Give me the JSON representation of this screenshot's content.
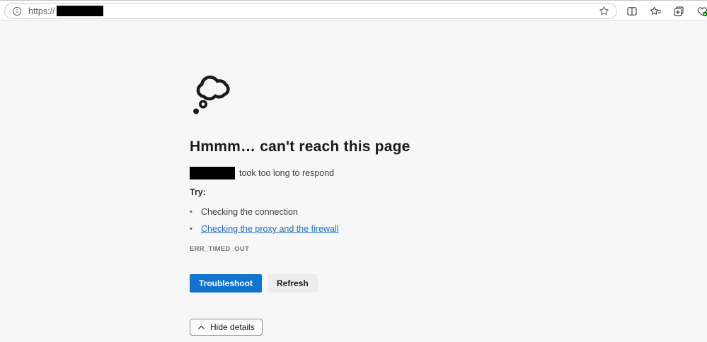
{
  "browser_chrome": {
    "address_bar": {
      "scheme": "https://",
      "url_redacted": true,
      "site_info_icon": "info-icon",
      "favorite_this_page_icon": "star-icon"
    },
    "toolbar_icons": [
      {
        "name": "split-screen-icon"
      },
      {
        "name": "favorites-icon"
      },
      {
        "name": "collections-icon"
      },
      {
        "name": "browser-essentials-icon",
        "badge_color": "#107c10"
      }
    ]
  },
  "error_page": {
    "illustration": "thought-bubble-icon",
    "title": "Hmmm… can't reach this page",
    "host_redacted": true,
    "description_suffix": "took too long to respond",
    "try_label": "Try:",
    "bullet_glyph": "•",
    "suggestions": [
      {
        "label": "Checking the connection",
        "is_link": false
      },
      {
        "label": "Checking the proxy and the firewall",
        "is_link": true
      }
    ],
    "error_code": "ERR_TIMED_OUT",
    "troubleshoot_button": "Troubleshoot",
    "refresh_button": "Refresh",
    "hide_details_button": "Hide details"
  },
  "colors": {
    "accent_blue": "#1374cf",
    "link_blue": "#1f6cc0",
    "page_background": "#f7f7f7"
  }
}
